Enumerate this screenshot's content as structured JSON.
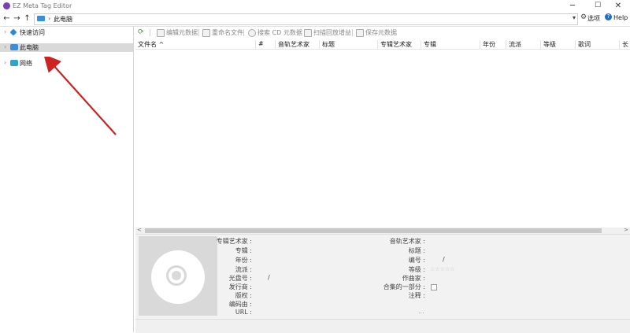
{
  "window": {
    "title": "EZ Meta Tag Editor",
    "controls": {
      "minimize": "─",
      "maximize": "☐",
      "close": "✕"
    }
  },
  "nav": {
    "back": "←",
    "forward": "→",
    "up": "↑",
    "sep": "›",
    "path": "此电脑",
    "dropdown": "▾"
  },
  "options": {
    "label": "选项",
    "icon": "⚙"
  },
  "help": {
    "label": "Help",
    "icon": "?"
  },
  "tree": {
    "items": [
      {
        "label": "快速访问",
        "icon_color": "#2b88d8"
      },
      {
        "label": "此电脑",
        "icon_color": "#3a8fd8"
      },
      {
        "label": "网络",
        "icon_color": "#2fa3c8"
      }
    ],
    "chevron": "›"
  },
  "toolbar": {
    "items": [
      "编辑元数据",
      "重命名文件",
      "搜索 CD 元数据",
      "扫描回放增益",
      "保存元数据"
    ]
  },
  "table": {
    "columns": [
      "文件名 ^",
      "#",
      "音轨艺术家",
      "标题",
      "专辑艺术家",
      "专辑",
      "年份",
      "流派",
      "等级",
      "歌词",
      "长"
    ]
  },
  "scrollbar": {
    "left": "<",
    "right": ">"
  },
  "details": {
    "left_fields": [
      {
        "label": "专辑艺术家 :",
        "value": ""
      },
      {
        "label": "专辑 :",
        "value": ""
      },
      {
        "label": "年份 :",
        "value": ""
      },
      {
        "label": "流派 :",
        "value": ""
      },
      {
        "label": "光盘号 :",
        "value": "/"
      },
      {
        "label": "发行商 :",
        "value": ""
      },
      {
        "label": "版权 :",
        "value": ""
      },
      {
        "label": "编码由 :",
        "value": ""
      },
      {
        "label": "URL :",
        "value": ""
      }
    ],
    "right_fields": [
      {
        "label": "音轨艺术家 :",
        "value": ""
      },
      {
        "label": "标题 :",
        "value": ""
      },
      {
        "label": "编号 :",
        "value": "/"
      },
      {
        "label": "等级 :",
        "value": ""
      },
      {
        "label": "作曲家 :",
        "value": ""
      },
      {
        "label": "合集的一部分 :",
        "value": ""
      },
      {
        "label": "注释 :",
        "value": ""
      }
    ],
    "rating_max": 5,
    "rating_value": 0,
    "more": "..."
  },
  "colors": {
    "arrow": "#cc2222",
    "tree_selected": "#d9d9d9"
  }
}
